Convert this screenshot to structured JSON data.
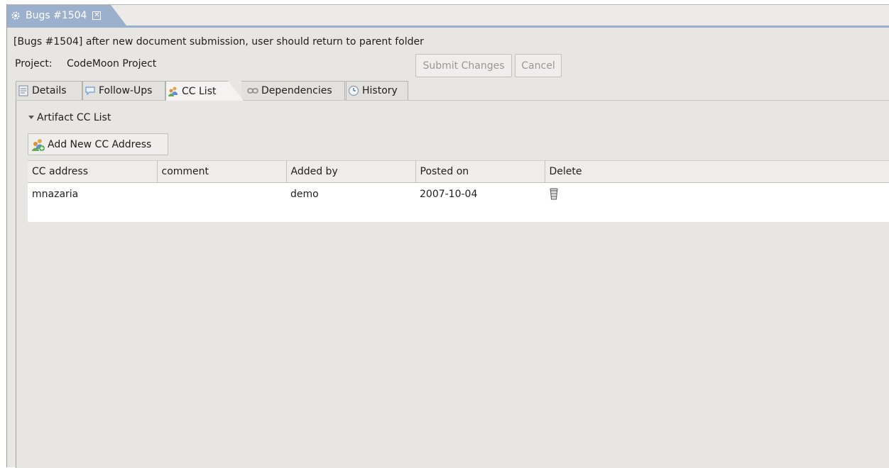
{
  "editor_tab": {
    "title": "Bugs #1504",
    "close_symbol": "✕",
    "icon": "gear-icon"
  },
  "summary": "[Bugs #1504] after new document submission, user should return to parent folder",
  "project": {
    "label": "Project:",
    "value": "CodeMoon Project"
  },
  "actions": {
    "submit_label": "Submit Changes",
    "cancel_label": "Cancel"
  },
  "tabs": [
    {
      "label": "Details",
      "icon": "document-icon"
    },
    {
      "label": "Follow-Ups",
      "icon": "speech-bubble-icon"
    },
    {
      "label": "CC List",
      "icon": "users-icon",
      "selected": true
    },
    {
      "label": "Dependencies",
      "icon": "link-icon"
    },
    {
      "label": "History",
      "icon": "clock-icon"
    }
  ],
  "section": {
    "title": "Artifact CC List",
    "add_button_label": "Add New CC Address"
  },
  "table": {
    "columns": [
      "CC address",
      "comment",
      "Added by",
      "Posted on",
      "Delete"
    ],
    "rows": [
      {
        "cc_address": "mnazaria",
        "comment": "",
        "added_by": "demo",
        "posted_on": "2007-10-04",
        "delete_icon": "trash-icon"
      }
    ]
  },
  "colors": {
    "active_tab": "#9bb0cc",
    "background": "#e8e6e2",
    "disabled_text": "#9a9894"
  }
}
